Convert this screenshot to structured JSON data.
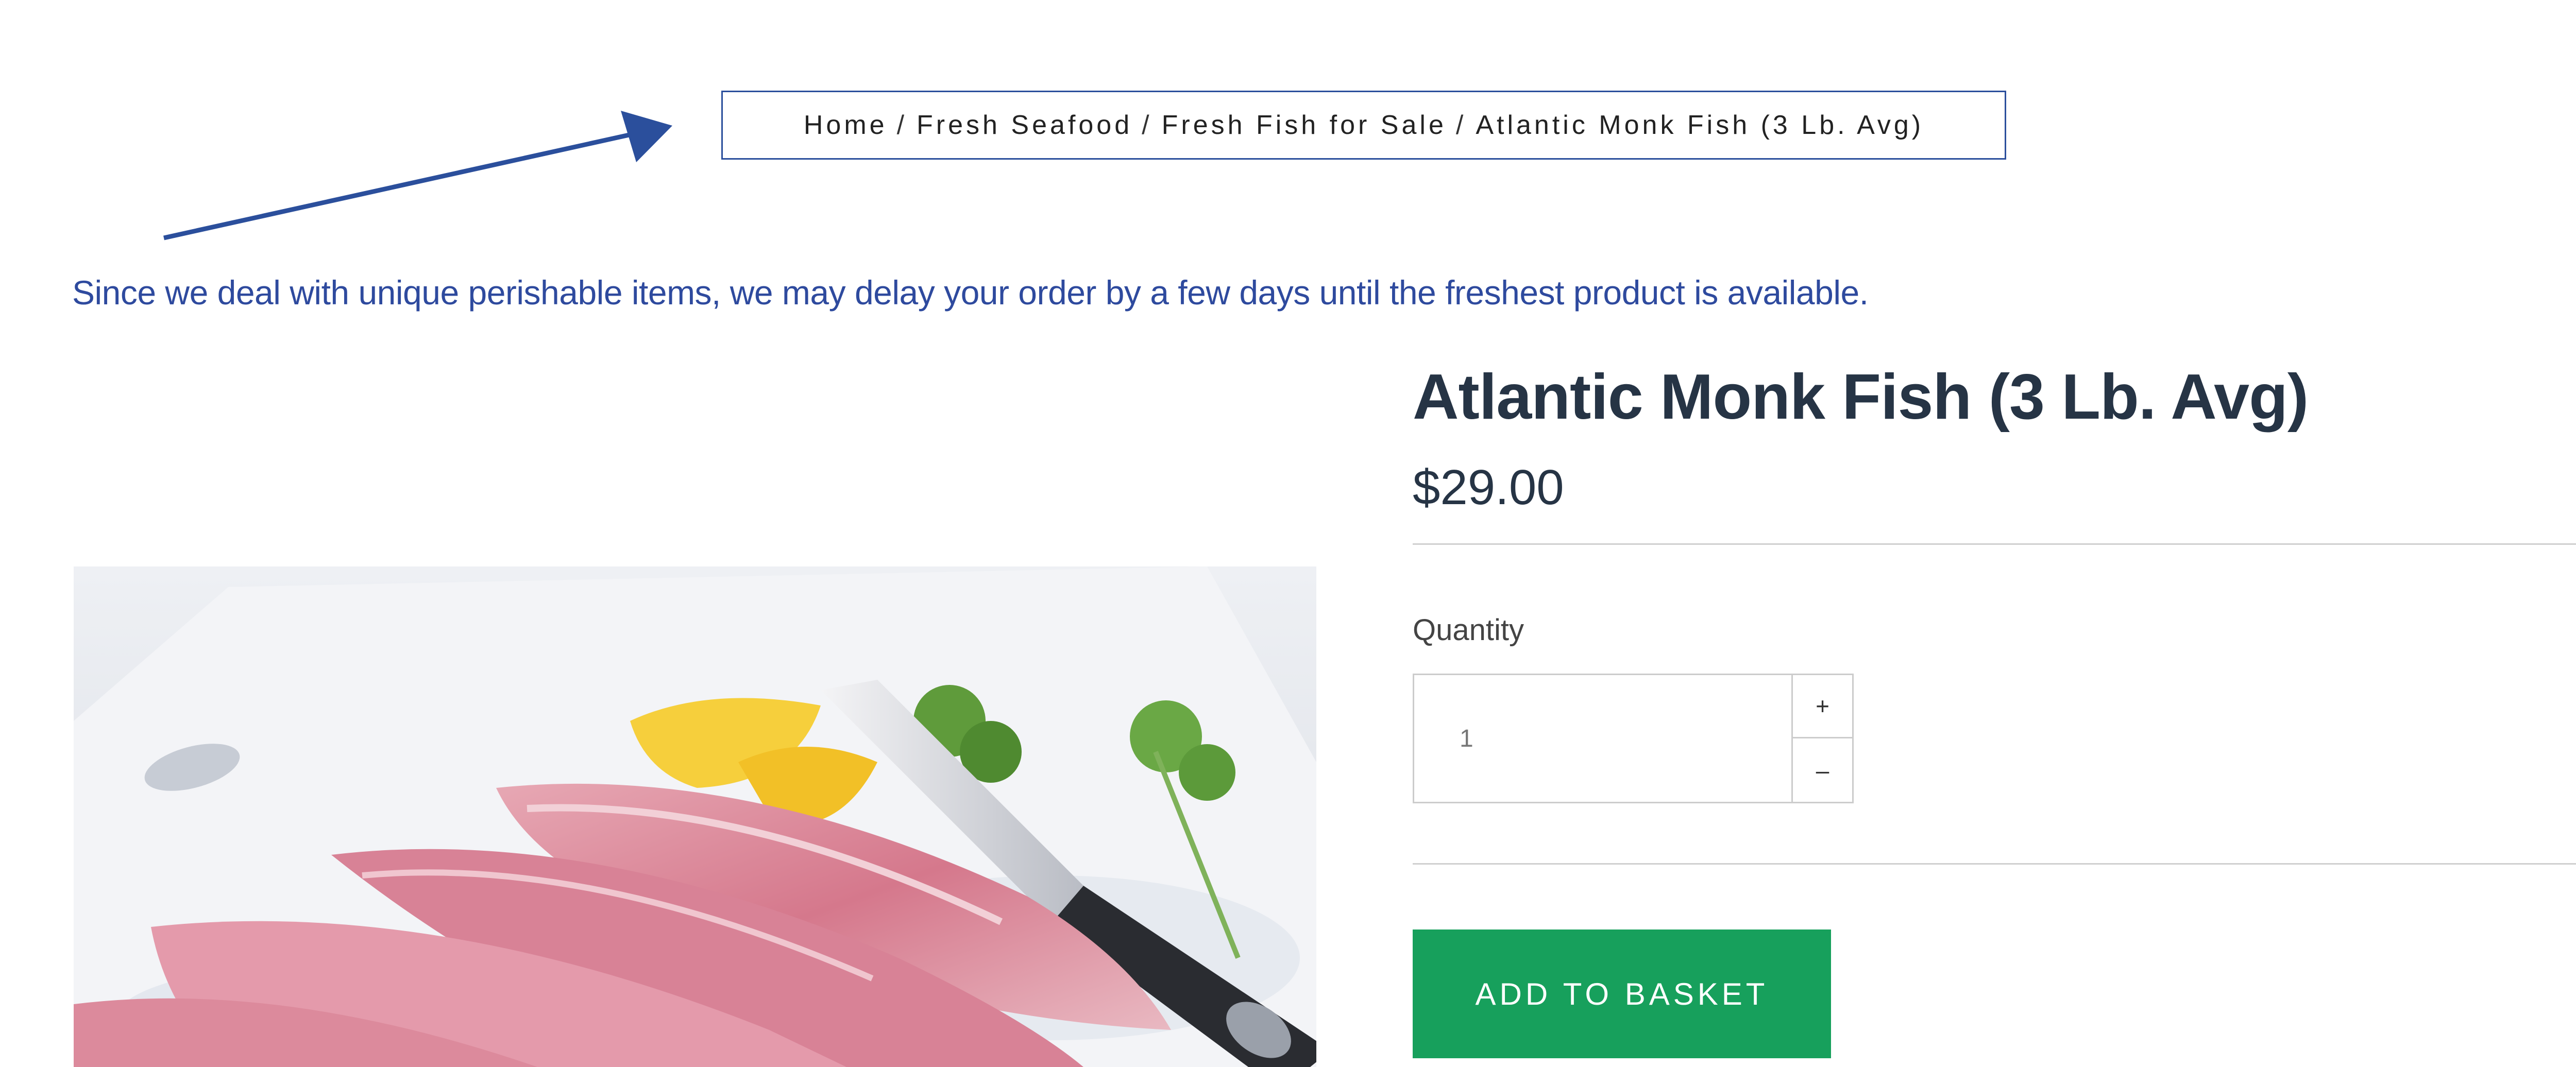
{
  "breadcrumb": {
    "items": [
      "Home",
      "Fresh Seafood",
      "Fresh Fish for Sale",
      "Atlantic Monk Fish (3 Lb. Avg)"
    ],
    "separator": "/"
  },
  "notice": "Since we deal with unique perishable items, we may delay your order by a few days until the freshest product is available.",
  "product": {
    "title": "Atlantic Monk Fish (3 Lb. Avg)",
    "price": "$29.00",
    "quantity_label": "Quantity",
    "quantity_value": "1",
    "increment_label": "+",
    "decrement_label": "–",
    "add_to_basket_label": "ADD TO BASKET"
  },
  "colors": {
    "accent_blue": "#2b4f9c",
    "button_green": "#17a05c",
    "title_text": "#263445"
  }
}
